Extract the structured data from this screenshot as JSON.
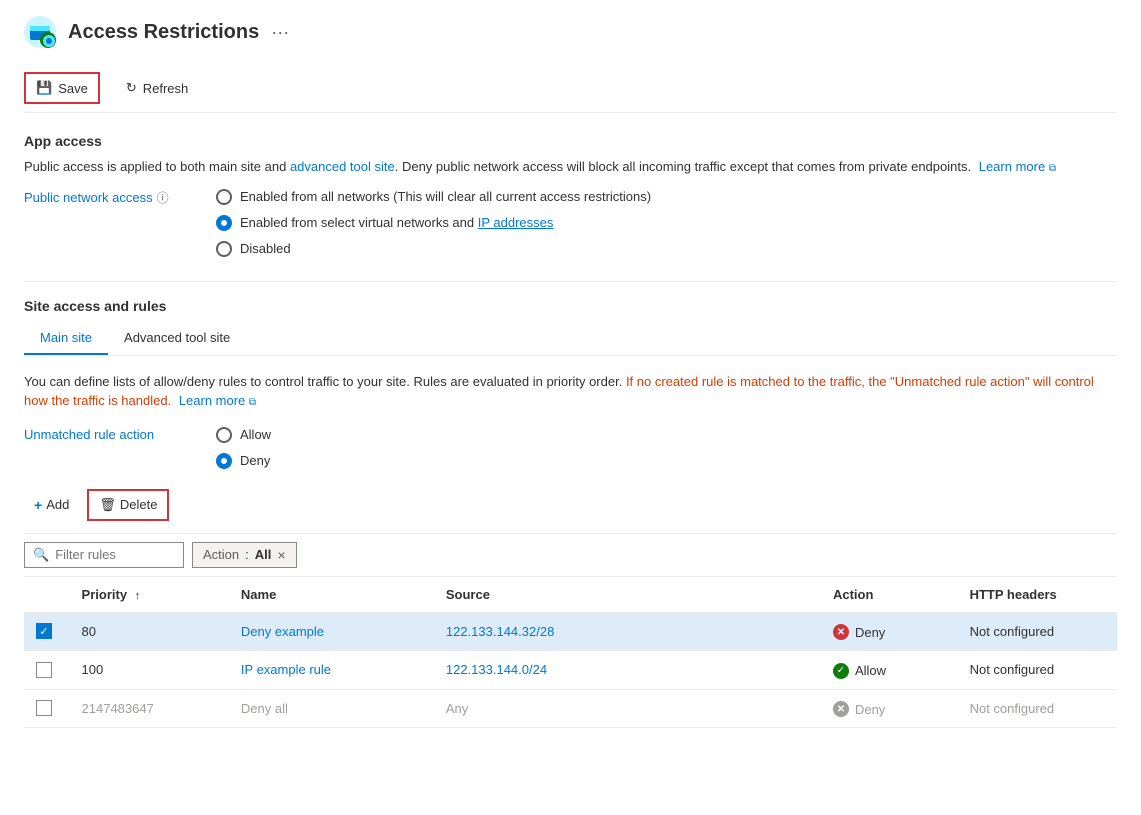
{
  "header": {
    "title": "Access Restrictions",
    "more_label": "···"
  },
  "toolbar": {
    "save_label": "Save",
    "refresh_label": "Refresh"
  },
  "app_access": {
    "section_title": "App access",
    "info_text_part1": "Public access is applied to both main site and ",
    "info_text_highlight": "advanced tool site",
    "info_text_part2": ". Deny public network access will block all incoming traffic except that comes from private endpoints.",
    "learn_more_label": "Learn more",
    "public_network_label": "Public network access",
    "options": [
      {
        "id": "opt1",
        "label": "Enabled from all networks (This will clear all current access restrictions)",
        "checked": false
      },
      {
        "id": "opt2",
        "label_part1": "Enabled from select virtual networks and ",
        "label_link": "IP addresses",
        "checked": true
      },
      {
        "id": "opt3",
        "label": "Disabled",
        "checked": false
      }
    ]
  },
  "site_access": {
    "section_title": "Site access and rules",
    "tabs": [
      {
        "id": "main",
        "label": "Main site",
        "active": true
      },
      {
        "id": "advanced",
        "label": "Advanced tool site",
        "active": false
      }
    ],
    "description_part1": "You can define lists of allow/deny rules to control traffic to your site. Rules are evaluated in priority order.",
    "description_highlight": " If no created rule is matched to the traffic, the \"Unmatched rule action\" will control how the traffic is handled.",
    "description_link": "Learn more",
    "unmatched_rule_label": "Unmatched rule action",
    "unmatched_options": [
      {
        "id": "u1",
        "label": "Allow",
        "checked": false
      },
      {
        "id": "u2",
        "label": "Deny",
        "checked": true
      }
    ]
  },
  "actions": {
    "add_label": "Add",
    "delete_label": "Delete"
  },
  "filter": {
    "placeholder": "Filter rules",
    "tag_label": "Action",
    "tag_separator": " : ",
    "tag_value": "All",
    "close_icon": "×"
  },
  "table": {
    "columns": [
      {
        "id": "checkbox",
        "label": ""
      },
      {
        "id": "priority",
        "label": "Priority",
        "sort": "↑"
      },
      {
        "id": "name",
        "label": "Name"
      },
      {
        "id": "source",
        "label": "Source"
      },
      {
        "id": "action",
        "label": "Action"
      },
      {
        "id": "http",
        "label": "HTTP headers"
      }
    ],
    "rows": [
      {
        "selected": true,
        "checkbox": true,
        "priority": "80",
        "name": "Deny example",
        "source": "122.133.144.32/28",
        "action": "Deny",
        "action_type": "deny",
        "http": "Not configured"
      },
      {
        "selected": false,
        "checkbox": false,
        "priority": "100",
        "name": "IP example rule",
        "source": "122.133.144.0/24",
        "action": "Allow",
        "action_type": "allow",
        "http": "Not configured"
      },
      {
        "selected": false,
        "checkbox": false,
        "priority": "2147483647",
        "name": "Deny all",
        "source": "Any",
        "action": "Deny",
        "action_type": "deny-gray",
        "http": "Not configured"
      }
    ]
  }
}
